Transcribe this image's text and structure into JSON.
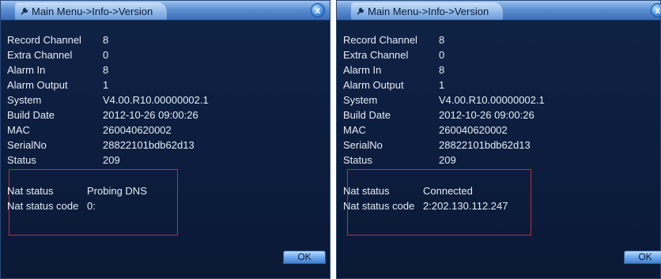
{
  "panels": [
    {
      "title": "Main Menu->Info->Version",
      "close_label": "x",
      "rows": [
        {
          "label": "Record Channel",
          "value": "8"
        },
        {
          "label": "Extra Channel",
          "value": "0"
        },
        {
          "label": "Alarm In",
          "value": "8"
        },
        {
          "label": "Alarm Output",
          "value": "1"
        },
        {
          "label": "System",
          "value": "V4.00.R10.00000002.1"
        },
        {
          "label": "Build Date",
          "value": "2012-10-26 09:00:26"
        },
        {
          "label": "MAC",
          "value": "260040620002"
        },
        {
          "label": "SerialNo",
          "value": "28822101bdb62d13"
        },
        {
          "label": "Status",
          "value": "209"
        }
      ],
      "nat": [
        {
          "label": "Nat status",
          "value": "Probing DNS"
        },
        {
          "label": "Nat status code",
          "value": "0:"
        }
      ],
      "ok_label": "OK"
    },
    {
      "title": "Main Menu->Info->Version",
      "close_label": "x",
      "rows": [
        {
          "label": "Record Channel",
          "value": "8"
        },
        {
          "label": "Extra Channel",
          "value": "0"
        },
        {
          "label": "Alarm In",
          "value": "8"
        },
        {
          "label": "Alarm Output",
          "value": "1"
        },
        {
          "label": "System",
          "value": "V4.00.R10.00000002.1"
        },
        {
          "label": "Build Date",
          "value": "2012-10-26 09:00:26"
        },
        {
          "label": "MAC",
          "value": "260040620002"
        },
        {
          "label": "SerialNo",
          "value": "28822101bdb62d13"
        },
        {
          "label": "Status",
          "value": "209"
        }
      ],
      "nat": [
        {
          "label": "Nat status",
          "value": "Connected"
        },
        {
          "label": "Nat status code",
          "value": "2:202.130.112.247"
        }
      ],
      "ok_label": "OK"
    }
  ],
  "colors": {
    "window_bg": "#0c1d3d",
    "titlebar": "#5d8fd1",
    "text": "#e7ecf5",
    "highlight_box": "#c0303a",
    "button": "#6ea9ec"
  },
  "icons": {
    "title_icon": "wrench-icon",
    "close_icon": "close-icon"
  }
}
